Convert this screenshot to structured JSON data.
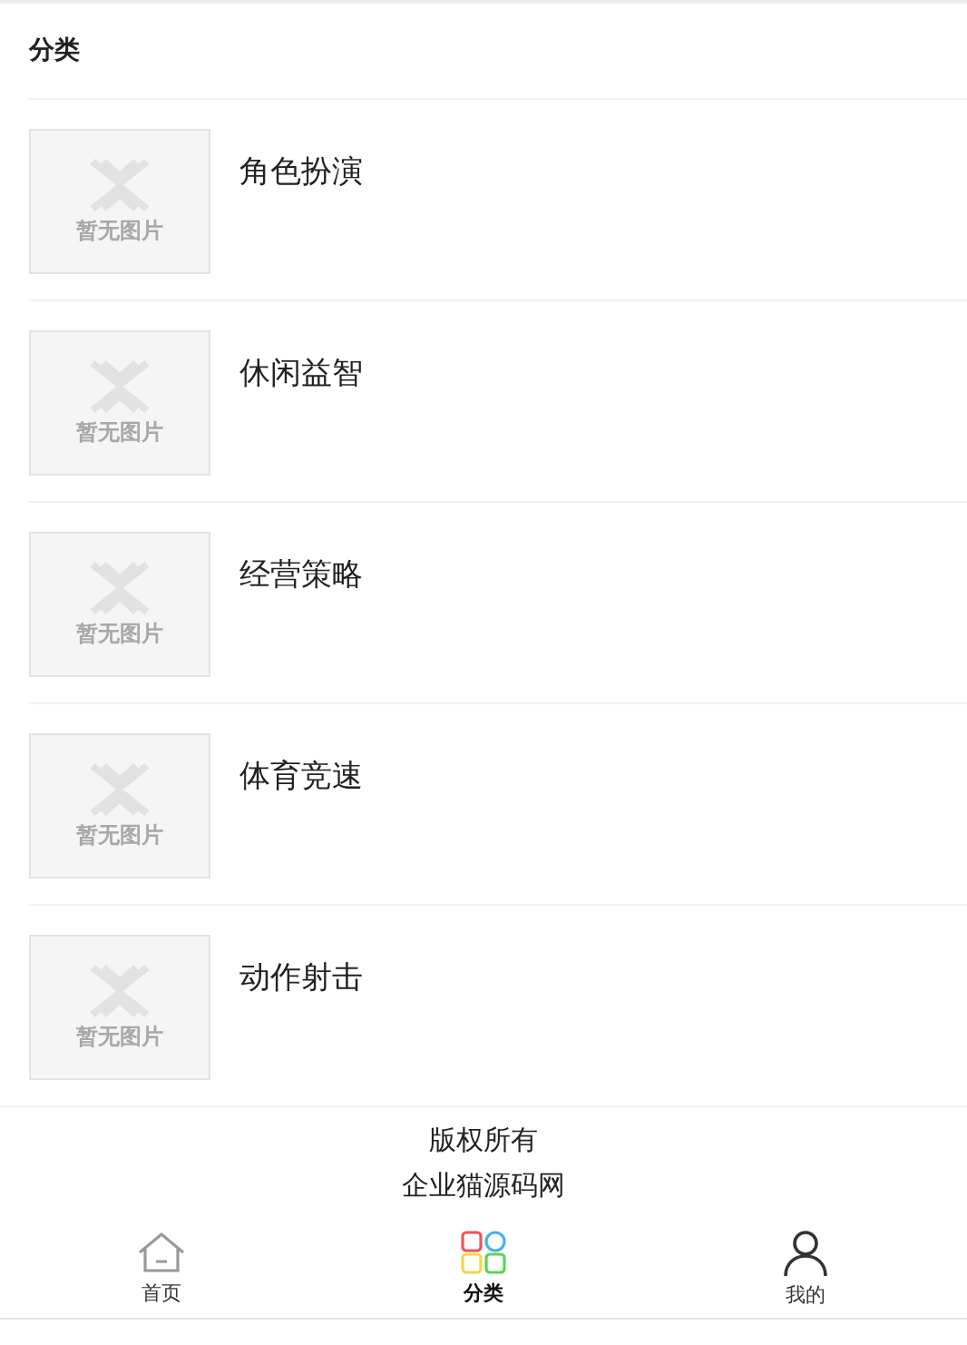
{
  "header": {
    "title": "分类"
  },
  "categories": [
    {
      "name": "角色扮演",
      "image_text": "暂无图片"
    },
    {
      "name": "休闲益智",
      "image_text": "暂无图片"
    },
    {
      "name": "经营策略",
      "image_text": "暂无图片"
    },
    {
      "name": "体育竞速",
      "image_text": "暂无图片"
    },
    {
      "name": "动作射击",
      "image_text": "暂无图片"
    }
  ],
  "footer": {
    "lines": [
      "版权所有",
      "企业猫源码网"
    ]
  },
  "tab_bar": [
    {
      "kind": "home",
      "label": "首页",
      "selected": false
    },
    {
      "kind": "category",
      "label": "分类",
      "selected": true
    },
    {
      "kind": "profile",
      "label": "我的",
      "selected": false
    }
  ]
}
